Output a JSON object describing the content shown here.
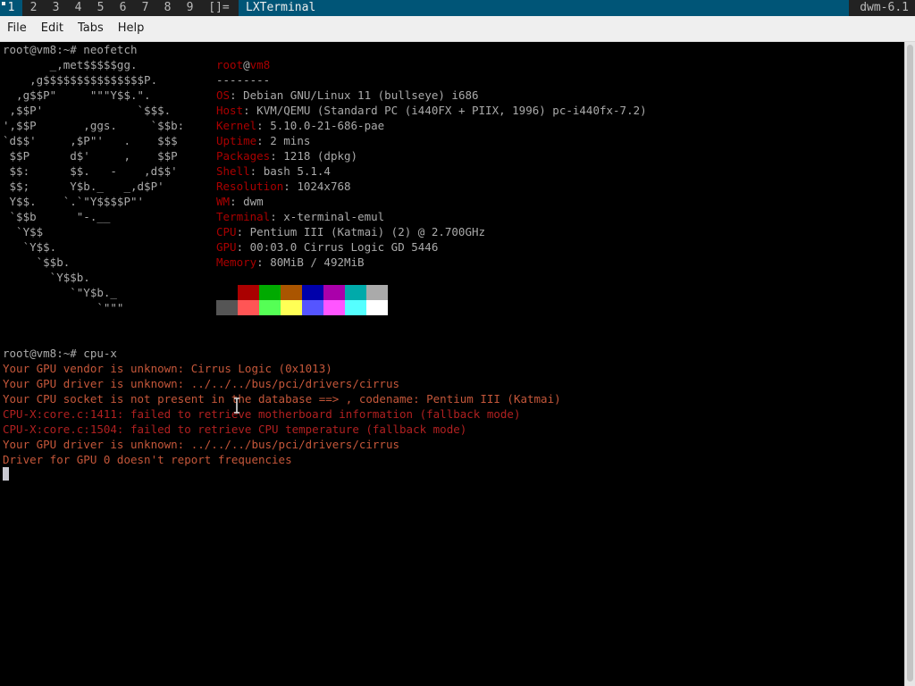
{
  "dwm": {
    "tags": [
      "1",
      "2",
      "3",
      "4",
      "5",
      "6",
      "7",
      "8",
      "9"
    ],
    "active_tag": "1",
    "layout_symbol": "[]=",
    "window_title": "LXTerminal",
    "status": "dwm-6.1"
  },
  "menu": {
    "items": [
      "File",
      "Edit",
      "Tabs",
      "Help"
    ]
  },
  "terminal": {
    "prompt1": "root@vm8:~# neofetch",
    "logo": [
      "       _,met$$$$$gg.",
      "    ,g$$$$$$$$$$$$$$$P.",
      "  ,g$$P\"     \"\"\"Y$$.\".",
      " ,$$P'              `$$$.",
      "',$$P       ,ggs.     `$$b:",
      "`d$$'     ,$P\"'   .    $$$",
      " $$P      d$'     ,    $$P",
      " $$:      $$.   -    ,d$$'",
      " $$;      Y$b._   _,d$P'",
      " Y$$.    `.`\"Y$$$$P\"'",
      " `$$b      \"-.__",
      "  `Y$$",
      "   `Y$$.",
      "     `$$b.",
      "       `Y$$b.",
      "          `\"Y$b._",
      "              `\"\"\""
    ],
    "info": {
      "user": "root",
      "at": "@",
      "host": "vm8",
      "separator": "--------",
      "rows": [
        {
          "label": "OS",
          "value": "Debian GNU/Linux 11 (bullseye) i686"
        },
        {
          "label": "Host",
          "value": "KVM/QEMU (Standard PC (i440FX + PIIX, 1996) pc-i440fx-7.2)"
        },
        {
          "label": "Kernel",
          "value": "5.10.0-21-686-pae"
        },
        {
          "label": "Uptime",
          "value": "2 mins"
        },
        {
          "label": "Packages",
          "value": "1218 (dpkg)"
        },
        {
          "label": "Shell",
          "value": "bash 5.1.4"
        },
        {
          "label": "Resolution",
          "value": "1024x768"
        },
        {
          "label": "WM",
          "value": "dwm"
        },
        {
          "label": "Terminal",
          "value": "x-terminal-emul"
        },
        {
          "label": "CPU",
          "value": "Pentium III (Katmai) (2) @ 2.700GHz"
        },
        {
          "label": "GPU",
          "value": "00:03.0 Cirrus Logic GD 5446"
        },
        {
          "label": "Memory",
          "value": "80MiB / 492MiB"
        }
      ]
    },
    "palette_top": [
      "#000000",
      "#aa0000",
      "#00aa00",
      "#aa5500",
      "#0000aa",
      "#aa00aa",
      "#00aaaa",
      "#aaaaaa"
    ],
    "palette_bottom": [
      "#555555",
      "#ff5555",
      "#55ff55",
      "#ffff55",
      "#5555ff",
      "#ff55ff",
      "#55ffff",
      "#ffffff"
    ],
    "prompt2": "root@vm8:~# cpu-x",
    "output": [
      {
        "text": "Your GPU vendor is unknown: Cirrus Logic (0x1013)",
        "kind": "err"
      },
      {
        "text": "Your GPU driver is unknown: ../../../bus/pci/drivers/cirrus",
        "kind": "err"
      },
      {
        "text": "Your CPU socket is not present in the database ==> , codename: Pentium III (Katmai)",
        "kind": "err"
      },
      {
        "text": "CPU-X:core.c:1411: failed to retrieve motherboard information (fallback mode)",
        "kind": "err2"
      },
      {
        "text": "CPU-X:core.c:1504: failed to retrieve CPU temperature (fallback mode)",
        "kind": "err2"
      },
      {
        "text": "Your GPU driver is unknown: ../../../bus/pci/drivers/cirrus",
        "kind": "err"
      },
      {
        "text": "Driver for GPU 0 doesn't report frequencies",
        "kind": "err"
      }
    ]
  },
  "colors": {
    "dwm_bar_bg": "#222222",
    "dwm_selected_bg": "#005577",
    "label_red": "#aa0000",
    "error_orange": "#c5573a"
  }
}
